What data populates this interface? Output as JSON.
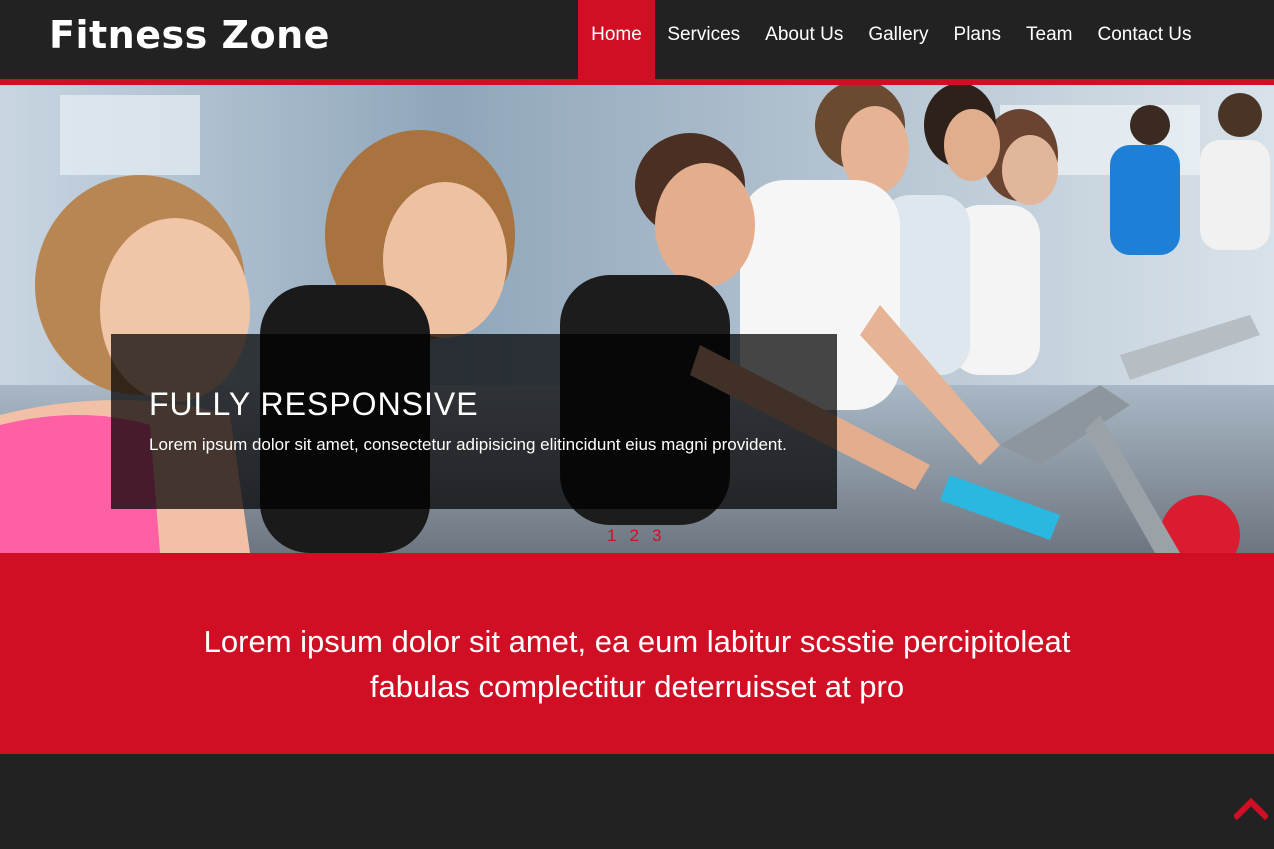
{
  "header": {
    "brand": "Fitness Zone",
    "nav": [
      "Home",
      "Services",
      "About Us",
      "Gallery",
      "Plans",
      "Team",
      "Contact Us"
    ],
    "active": "Home"
  },
  "hero": {
    "title": "FULLY RESPONSIVE",
    "text": "Lorem ipsum dolor sit amet, consectetur adipisicing elitincidunt eius magni provident.",
    "pager": [
      "1",
      "2",
      "3"
    ]
  },
  "band": {
    "line1": "Lorem ipsum dolor sit amet, ea eum labitur scsstie percipitoleat",
    "line2": "fabulas complectitur deterruisset at pro"
  },
  "colors": {
    "accent": "#d10f24",
    "dark": "#222222"
  },
  "icons": {
    "scroll_top": "chevron-up-icon"
  }
}
